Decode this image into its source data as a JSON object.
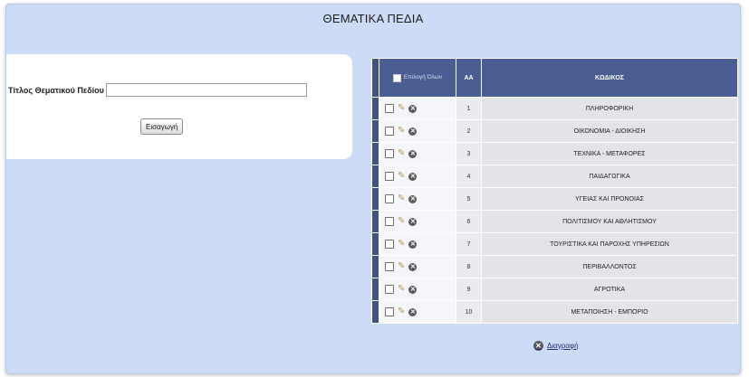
{
  "page": {
    "title": "ΘΕΜΑΤΙΚΑ ΠΕΔΙΑ"
  },
  "form": {
    "label": "Τίτλος Θεματικού Πεδίου",
    "input_value": "",
    "insert_label": "Εισαγωγή"
  },
  "table": {
    "select_all_label": "Επιλογή Όλων",
    "col_aa": "ΑΑ",
    "col_code": "ΚΩΔΙΚΟΣ",
    "rows": [
      {
        "aa": "1",
        "code": "ΠΛΗΡΟΦΟΡΙΚΗ"
      },
      {
        "aa": "2",
        "code": "ΟΙΚΟΝΟΜΙΑ - ΔΙΟΙΚΗΣΗ"
      },
      {
        "aa": "3",
        "code": "ΤΕΧΝΙΚΑ - ΜΕΤΑΦΟΡΕΣ"
      },
      {
        "aa": "4",
        "code": "ΠΑΙΔΑΓΩΓΙΚΑ"
      },
      {
        "aa": "5",
        "code": "ΥΓΕΙΑΣ ΚΑΙ ΠΡΟΝΟΙΑΣ"
      },
      {
        "aa": "6",
        "code": "ΠΟΛΙΤΙΣΜΟΥ ΚΑΙ ΑΘΛΗΤΙΣΜΟΥ"
      },
      {
        "aa": "7",
        "code": "ΤΟΥΡΙΣΤΙΚΑ ΚΑΙ ΠΑΡΟΧΗΣ ΥΠΗΡΕΣΙΩΝ"
      },
      {
        "aa": "8",
        "code": "ΠΕΡΙΒΑΛΛΟΝΤΟΣ"
      },
      {
        "aa": "9",
        "code": "ΑΓΡΟΤΙΚΑ"
      },
      {
        "aa": "10",
        "code": "ΜΕΤΑΠΟΙΗΣΗ - ΕΜΠΟΡΙΟ"
      }
    ]
  },
  "delete_label": "Διαγραφή",
  "colors": {
    "background": "#ccdcf7",
    "header": "#4a5e93",
    "row_bar": "#3d5286"
  },
  "icons": {
    "edit": "pencil-icon",
    "delete": "delete-icon"
  }
}
